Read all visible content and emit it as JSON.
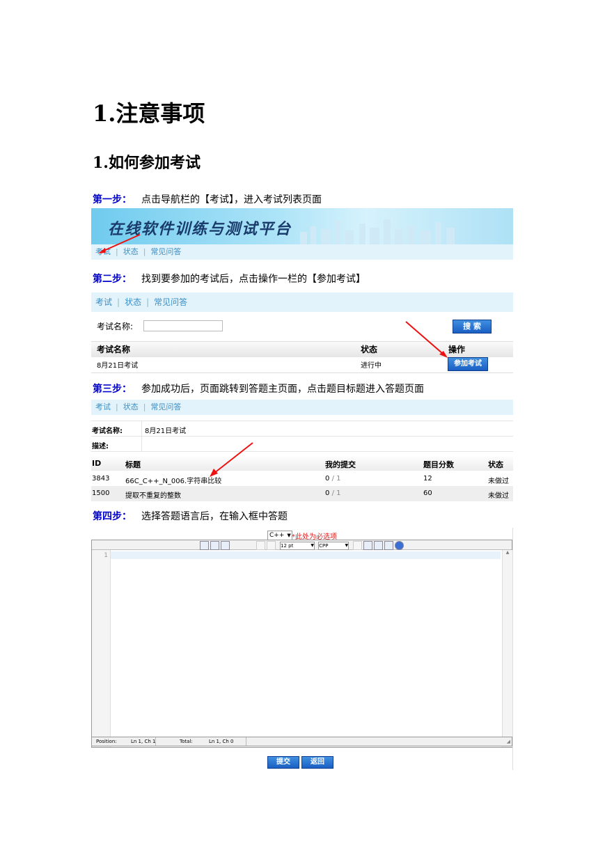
{
  "heading1": "1.注意事项",
  "heading2": "1.如何参加考试",
  "steps": [
    {
      "label": "第一步：",
      "text": "点击导航栏的【考试】，进入考试列表页面"
    },
    {
      "label": "第二步：",
      "text": "找到要参加的考试后，点击操作一栏的【参加考试】"
    },
    {
      "label": "第三步：",
      "text": "参加成功后，页面跳转到答题主页面，点击题目标题进入答题页面"
    },
    {
      "label": "第四步：",
      "text": "选择答题语言后，在输入框中答题"
    }
  ],
  "banner_title": "在线软件训练与测试平台",
  "nav": {
    "exam": "考试",
    "status": "状态",
    "faq": "常见问答",
    "sep": "|"
  },
  "exam_list": {
    "search_label": "考试名称:",
    "search_placeholder": "",
    "search_button": "搜 索",
    "columns": [
      "考试名称",
      "状态",
      "操作"
    ],
    "row": {
      "name": "8月21日考试",
      "status": "进行中",
      "action": "参加考试"
    }
  },
  "exam_detail": {
    "name_label": "考试名称:",
    "name_value": "8月21日考试",
    "desc_label": "描述:",
    "columns": [
      "ID",
      "标题",
      "我的提交",
      "题目分数",
      "状态"
    ],
    "rows": [
      {
        "id": "3843",
        "title": "66C_C++_N_006.字符串比较",
        "submit": "0",
        "total": "1",
        "score": "12",
        "state": "未做过"
      },
      {
        "id": "1500",
        "title": "提取不重复的整数",
        "submit": "0",
        "total": "1",
        "score": "60",
        "state": "未做过"
      }
    ],
    "slash": "/"
  },
  "editor": {
    "language": "C++",
    "required_note": "*此处为必选项",
    "font_size": "12 pt",
    "syntax": "CPP",
    "line_number": "1",
    "status": {
      "position_label": "Position:",
      "position_value": "Ln 1, Ch 1",
      "total_label": "Total:",
      "total_value": "Ln 1, Ch 0"
    },
    "submit_button": "提交",
    "back_button": "返回"
  }
}
